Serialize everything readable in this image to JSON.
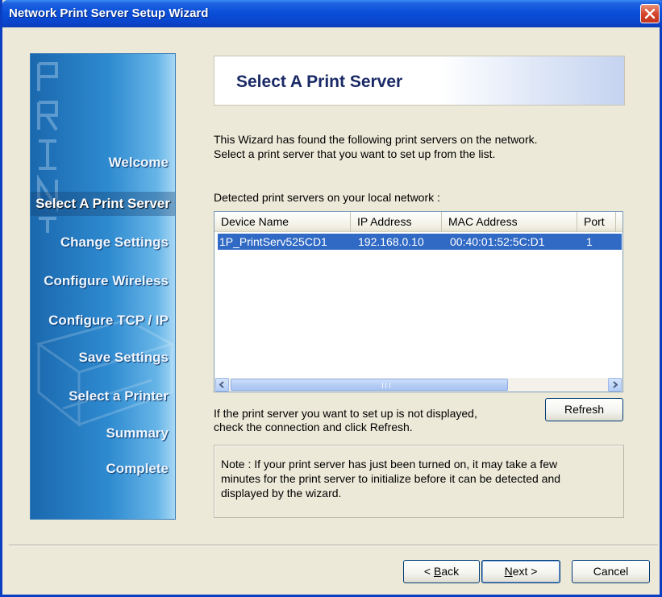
{
  "window": {
    "title": "Network Print Server Setup Wizard"
  },
  "sidebar": {
    "watermark": "PRINT",
    "items": [
      {
        "label": "Welcome",
        "active": false
      },
      {
        "label": "Select A Print Server",
        "active": true
      },
      {
        "label": "Change Settings",
        "active": false
      },
      {
        "label": "Configure Wireless",
        "active": false
      },
      {
        "label": "Configure TCP / IP",
        "active": false
      },
      {
        "label": "Save Settings",
        "active": false
      },
      {
        "label": "Select a Printer",
        "active": false
      },
      {
        "label": "Summary",
        "active": false
      },
      {
        "label": "Complete",
        "active": false
      }
    ]
  },
  "header": {
    "title": "Select A Print Server"
  },
  "intro": {
    "line1": "This Wizard has found the following print servers on the network.",
    "line2": "Select a print server that you want to set up from the list."
  },
  "list": {
    "label": "Detected print servers on your local network :",
    "columns": [
      "Device Name",
      "IP Address",
      "MAC Address",
      "Port"
    ],
    "rows": [
      {
        "device_name": "1P_PrintServ525CD1",
        "ip_address": "192.168.0.10",
        "mac_address": "00:40:01:52:5C:D1",
        "port": "1",
        "selected": true
      }
    ]
  },
  "refresh_hint": {
    "line1": "If the print server you want to set up is not displayed,",
    "line2": "check the connection and click Refresh."
  },
  "note": {
    "line1": "Note : If your print server has just been turned on, it may take a few",
    "line2": "minutes for the print server to initialize before it can be detected and",
    "line3": "displayed by the wizard."
  },
  "buttons": {
    "refresh": "Refresh",
    "back_prefix": "< ",
    "back_accel": "B",
    "back_rest": "ack",
    "next_accel": "N",
    "next_rest": "ext >",
    "cancel": "Cancel"
  },
  "colors": {
    "titlebar": "#0a4fd9",
    "selection": "#316ac5",
    "sidebar": "#2f8bd0",
    "header_title": "#1a2a66"
  }
}
